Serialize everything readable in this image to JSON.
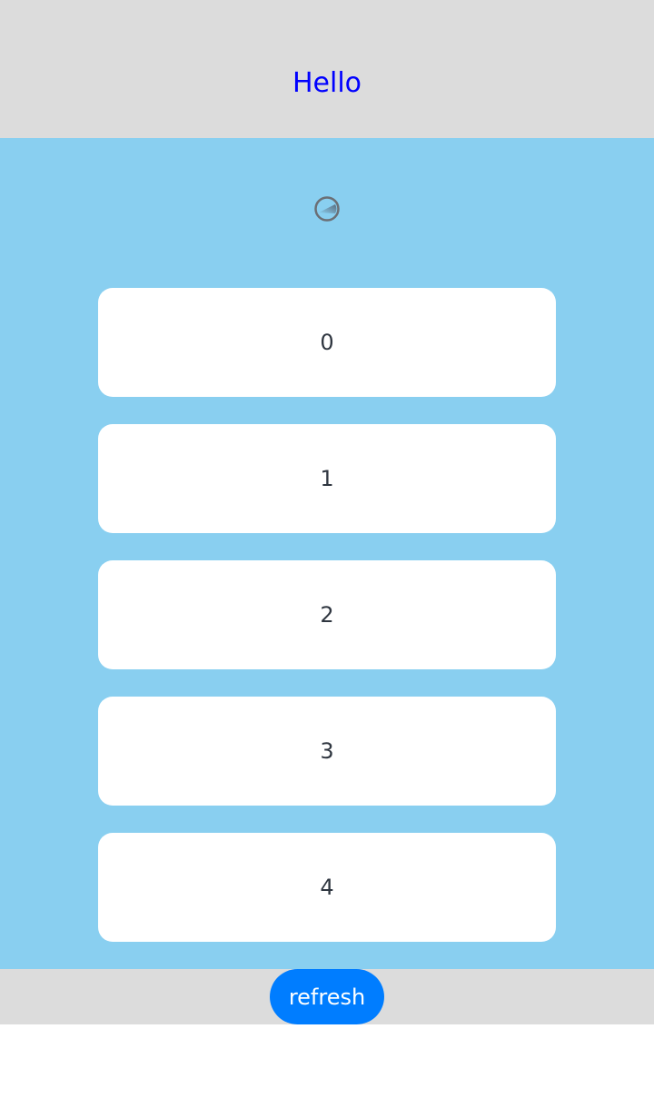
{
  "header": {
    "title": "Hello"
  },
  "content": {
    "background": "#89cff0",
    "loading_icon": "loading-spinner-icon",
    "items": [
      "0",
      "1",
      "2",
      "3",
      "4"
    ]
  },
  "footer": {
    "refresh_label": "refresh",
    "button_color": "#007dff"
  }
}
